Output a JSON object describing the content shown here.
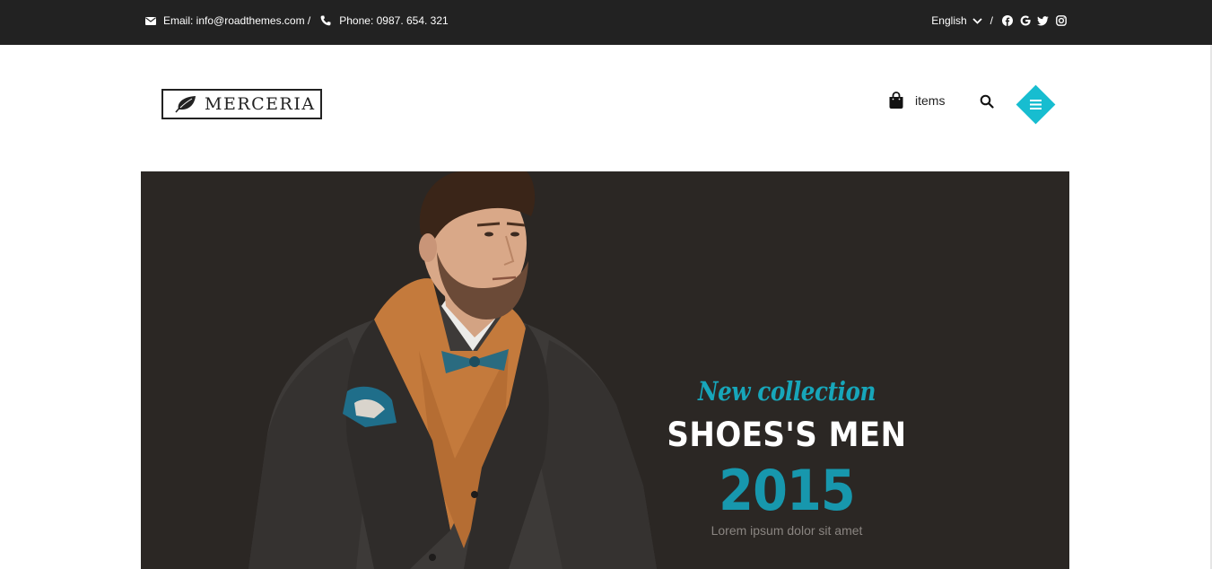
{
  "topbar": {
    "email_label": "Email: info@roadthemes.com /",
    "phone_label": "Phone: 0987. 654. 321",
    "language": "English",
    "divider": "/",
    "socials": [
      "facebook-icon",
      "google-icon",
      "twitter-icon",
      "instagram-icon"
    ]
  },
  "header": {
    "logo_text": "MERCERIA",
    "cart_label": "items",
    "accent_color": "#17bdd0"
  },
  "banner": {
    "script_text": "New collection",
    "title": "SHOES'S MEN",
    "year": "2015",
    "subtitle": "Lorem ipsum dolor sit amet",
    "background_color": "#2b2724",
    "year_color": "#1797ad"
  }
}
